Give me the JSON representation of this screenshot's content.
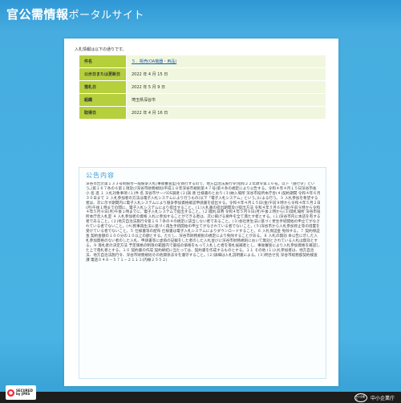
{
  "header": {
    "title_main": "官公需情報",
    "title_sub": "ポータルサイト"
  },
  "intro": "入札情報は以下の通りです。",
  "info_rows": [
    {
      "label": "件名",
      "value": "５．販売(OA機器・用品)",
      "link": true
    },
    {
      "label": "公示日または更新日",
      "value": "2022 年 4 月 15 日"
    },
    {
      "label": "落札日",
      "value": "2022 年 5 月 9 日"
    },
    {
      "label": "組織",
      "value": "埼玉県深谷市"
    },
    {
      "label": "取得日",
      "value": "2022 年 4 月 16 日"
    }
  ],
  "notice": {
    "title": "公告内容",
    "body": "深谷市告示第１３３号制限付一般競争入札(事後審査型)を執行するので、地方自治法施行令(昭和２２年政令第１６号。以下「施行令」という。)第１６７条の６第１項及び深谷市財務規則(平成１８年深谷市規則第４７号)第４条の規定により公告する。令和４年４月１５日深谷市長 小 島 進 １ 入札対象事項 (１)件 名 深谷市サーバOS調達 (２)調 達 仕様書のとおり (３)納入場所 深谷市役所本庁舎(４)契約期間 令和４年６月３０日まで ２ 入札参加者の方法は電子入札システムにより行うもの(以下「電子入札システム」という。)による行う。３ 入札参加を希望する者は、次に示す期間内に電子入札システムにより競争参加資格確認申請書を提出する。令和４年４月１５日(金)午前９時から令和４年５月２日(月)午後１時までの間に、電子入札システムにより提出すること。(１)入札書の提出期間及び提出方法 令和４年５月６日(金)午前９時から令和４年５月９日(月)午後１時までに、電子入札システムで提出すること。(２)開札日時 令和４年５月９日(月)午後２時から(３)開札場所 深谷市役所本庁舎入札室 ４ 入札参加者の資格 入札に参加することができる者は、次に掲げる要件を全て満たす者とする。(１)深谷市内に本店を有する者であること。(２)地方自治法施行令第１６７条の４の規定に該当しない者であること。(３)会社更生法に基づく更生手続開始の申立てがなされている者でないこと。(４)民事再生法に基づく再生手続開始の申立てがなされている者でないこと。(５)深谷市から入札参加停止等の措置を受けている者でないこと。５ 仕様書等の配布 仕様書は電子入札システムによりダウンロードすること。６ 入札保証金 免除する。７ 契約保証金 契約金額の１００分の１０以上の額とする。ただし、深谷市財務規則の規定により免除することがある。８ 入札の無効 本公告に示した入札参加資格のない者のした入札、申請書等に虚偽の記載をした者のした入札並びに深谷市財務規則において無効とされている入札は無効とする。９ 落札者の決定方法 予定価格の制限の範囲内で最低の価格をもって入札した者を落札候補者とし、事後審査により入札参加資格を確認した上で落札者とする。１０ 契約書の作成 契約締結に当たっては、契約書を作成するものとする。１１ その他 (１)入札参加者は、地方自治法、地方自治法施行令、深谷市財務規則その他関係法令を遵守すること。(２)詳細は入札説明書による。(３)問合せ先 深谷市総務部契約検査課 電話０４８－５７１－２１１１(内線２５５２)",
    "contact": "電話０４８－５７１－２１１１(内線２５５２)"
  },
  "footer": {
    "badge_line1": "SECURED",
    "badge_line2": "by JPRS",
    "agency": "中小企業庁",
    "seal_text": "中小企業庁"
  },
  "colors": {
    "accent": "#49b3e4",
    "label_bg": "#b5cf3d",
    "value_bg": "#f1f7de"
  }
}
